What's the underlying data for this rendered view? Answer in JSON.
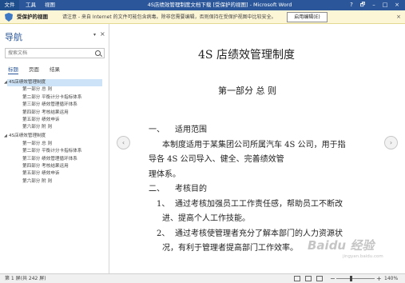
{
  "titlebar": {
    "file_tab": "文件",
    "tabs": [
      "工具",
      "视图"
    ],
    "document_title": "4S店绩效管理制度文档下载 [受保护的视图] - Microsoft Word",
    "controls": [
      "?",
      "🗗",
      "–",
      "□",
      "×"
    ]
  },
  "protected_view": {
    "title": "受保护的视图",
    "message": "请注意 - 来自 Internet 的文件可能包含病毒。除非您需要编辑，否则保持在受保护视图中比较安全。",
    "enable_button": "启用编辑(E)",
    "close": "×",
    "colors": {
      "bar": "#fcf6d6",
      "shield": "#3c78c3"
    }
  },
  "navigation": {
    "title": "导航",
    "pin": "▾",
    "close": "×",
    "search_placeholder": "搜索文档",
    "tabs": [
      "标题",
      "页面",
      "结果"
    ],
    "active_tab": "标题",
    "outline": [
      {
        "level": 1,
        "text": "4S店绩效管理制度",
        "selected": true
      },
      {
        "level": 2,
        "text": "第一部分 总 则"
      },
      {
        "level": 2,
        "text": "第二部分 平衡计分卡指标体系"
      },
      {
        "level": 2,
        "text": "第三部分 绩效管理循环体系"
      },
      {
        "level": 2,
        "text": "第四部分 考核结果运用"
      },
      {
        "level": 2,
        "text": "第五部分 绩效申诉"
      },
      {
        "level": 2,
        "text": "第六部分 附 则"
      },
      {
        "level": 1,
        "text": "4S店绩效管理制度",
        "selected": false
      },
      {
        "level": 2,
        "text": "第一部分 总 则"
      },
      {
        "level": 2,
        "text": "第二部分 平衡计分卡指标体系"
      },
      {
        "level": 2,
        "text": "第三部分 绩效管理循环体系"
      },
      {
        "level": 2,
        "text": "第四部分 考核结果运用"
      },
      {
        "level": 2,
        "text": "第五部分 绩效申诉"
      },
      {
        "level": 2,
        "text": "第六部分 附 则"
      }
    ]
  },
  "document": {
    "title": "4S 店绩效管理制度",
    "part_heading": "第一部分 总 则",
    "sec1_num": "一、",
    "sec1_title": "适用范围",
    "sec1_body_1": "本制度适用于某集团公司所属汽车 4S 公司，用于指",
    "sec1_body_2": "导各 4S 公司导入、健全、完善绩效管",
    "sec1_body_3": "理体系。",
    "sec2_num": "二、",
    "sec2_title": "考核目的",
    "item1_num": "1、",
    "item1_line1": "通过考核加强员工工作责任感，帮助员工不断改",
    "item1_line2": "进、提高个人工作技能。",
    "item2_num": "2、",
    "item2_line1": "通过考核使管理者充分了解本部门的人力资源状",
    "item2_line2": "况，有利于管理者提高部门工作效率。",
    "prev_arrow": "‹",
    "next_arrow": "›"
  },
  "statusbar": {
    "page_info": "第 1 屏(共 242 屏)",
    "zoom_minus": "−",
    "zoom_plus": "+",
    "zoom_level": "140%"
  },
  "watermark": {
    "text": "Baidu 经验",
    "sub": "jingyan.baidu.com"
  }
}
